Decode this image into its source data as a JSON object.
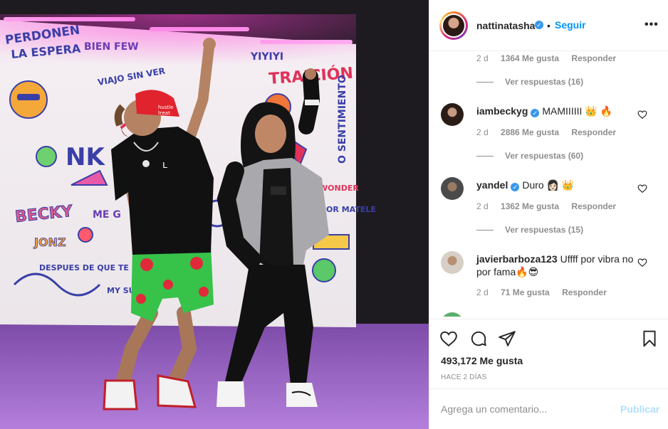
{
  "post": {
    "author": {
      "username": "nattinatasha",
      "verified": true,
      "follow_label": "Seguir",
      "separator": "•",
      "more_icon": "more-options-icon"
    },
    "photo": {
      "wall_text": [
        "PERDONEN",
        "LA ESPERA",
        "BIEN FEW",
        "VIAJO SIN VER",
        "NK",
        "BECKY",
        "JONZ",
        "DESPUES DE QUE TE PERDI",
        "MY SUN REMIX",
        "ME G",
        "TRAICIÓN",
        "YIYIYI",
        "O SENTIMIENTO",
        "POR MATELE",
        "WONDER"
      ],
      "cap_text": "hustle treat"
    },
    "comments": [
      {
        "meta": {
          "age": "2 d",
          "likes": "1364 Me gusta",
          "reply": "Responder"
        },
        "view_replies": "Ver respuestas (16)"
      },
      {
        "username": "iambeckyg",
        "verified": true,
        "text": "MAMIIIIII 👑 🔥",
        "meta": {
          "age": "2 d",
          "likes": "2886 Me gusta",
          "reply": "Responder"
        },
        "view_replies": "Ver respuestas (60)"
      },
      {
        "username": "yandel",
        "verified": true,
        "text": "Duro 👩🏻 👑",
        "meta": {
          "age": "2 d",
          "likes": "1362 Me gusta",
          "reply": "Responder"
        },
        "view_replies": "Ver respuestas (15)"
      },
      {
        "username": "javierbarboza123",
        "verified": false,
        "text": "Uffff por vibra no por fama🔥😎",
        "meta": {
          "age": "2 d",
          "likes": "71 Me gusta",
          "reply": "Responder"
        }
      }
    ],
    "actions": {
      "like_icon": "heart-icon",
      "comment_icon": "comment-icon",
      "share_icon": "share-icon",
      "save_icon": "bookmark-icon"
    },
    "likes_total": "493,172 Me gusta",
    "posted": "HACE 2 DÍAS",
    "add_comment": {
      "placeholder": "Agrega un comentario...",
      "post_label": "Publicar"
    },
    "colors": {
      "accent": "#0095f6",
      "verified": "#3897f0",
      "muted": "#8e8e8e",
      "post_disabled": "#b2dffc",
      "neon": "#ff38d2",
      "floor": "#9a5fc7"
    }
  }
}
